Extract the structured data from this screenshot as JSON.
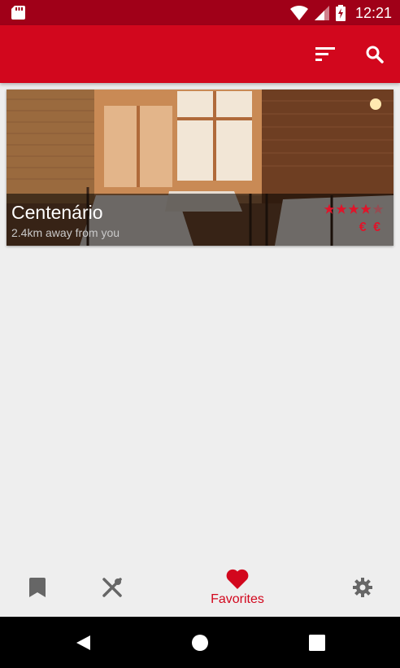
{
  "status_bar": {
    "time": "12:21",
    "icons": [
      "sd-card-icon",
      "wifi-icon",
      "signal-icon",
      "battery-charging-icon"
    ]
  },
  "app_bar": {
    "actions": [
      {
        "icon": "sort-icon"
      },
      {
        "icon": "search-icon"
      }
    ],
    "color": "#d2071d"
  },
  "restaurants": [
    {
      "name": "Centenário",
      "distance": "2.4km away from you",
      "rating": 4,
      "rating_max": 5,
      "price": "€ €",
      "image": "restaurant-interior-photo"
    }
  ],
  "bottom_nav": {
    "items": [
      {
        "icon": "bookmark-icon",
        "label": "",
        "active": false
      },
      {
        "icon": "fork-knife-icon",
        "label": "",
        "active": false
      },
      {
        "icon": "heart-icon",
        "label": "Favorites",
        "active": true
      },
      {
        "icon": "gear-icon",
        "label": "",
        "active": false
      }
    ],
    "active_color": "#d2071d",
    "inactive_color": "#666666"
  },
  "system_nav": {
    "icons": [
      "back-icon",
      "home-icon",
      "recents-icon"
    ]
  }
}
